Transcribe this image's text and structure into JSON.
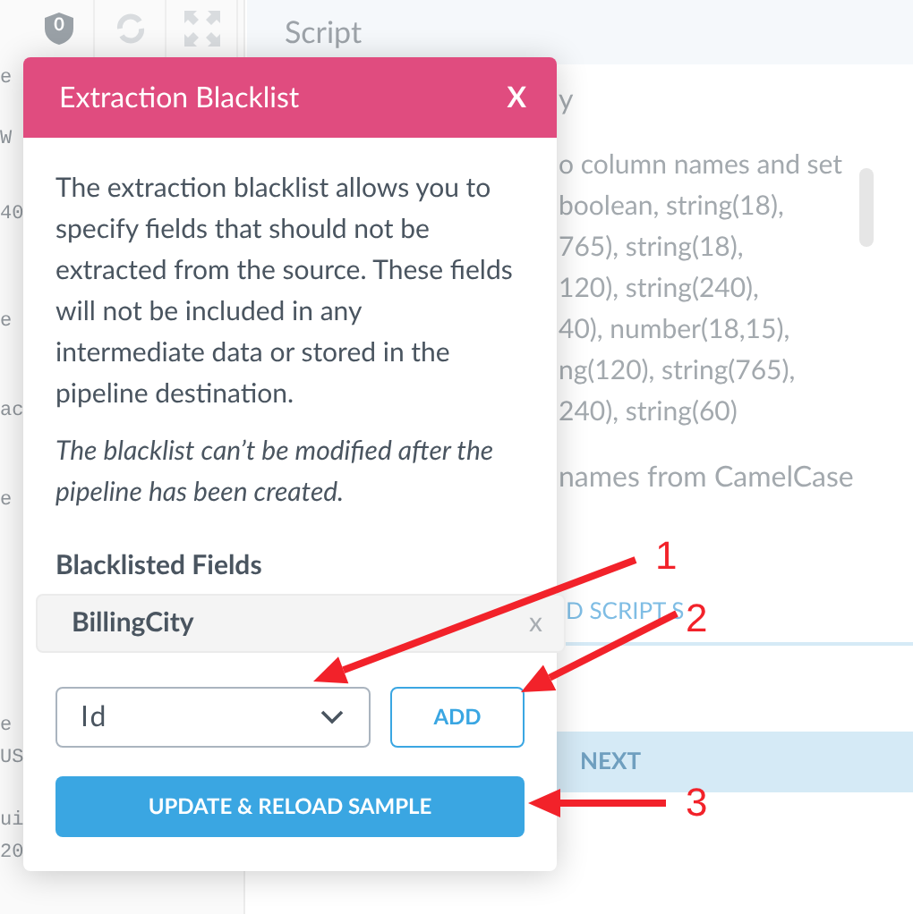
{
  "sidebar": {
    "toolbar": [
      {
        "kind": "shield",
        "badge": "0"
      },
      {
        "kind": "refresh"
      },
      {
        "kind": "expand"
      }
    ],
    "fragments": [
      "e",
      "W",
      "40",
      "e",
      "ac",
      "e",
      "e",
      "US",
      "ui",
      "20"
    ]
  },
  "main": {
    "header": "Script",
    "heading_fragment": "y",
    "lines": [
      "o column names and set",
      "boolean, string(18),",
      "765), string(18),",
      "120), string(240),",
      "40), number(18,15),",
      "ng(120), string(765),",
      "240), string(60)"
    ],
    "option_fragment": "names from CamelCase",
    "link": "D SCRIPT S",
    "next_button": "NEXT"
  },
  "dialog": {
    "title": "Extraction Blacklist",
    "close": "X",
    "description": "The extraction blacklist allows you to specify fields that should not be extracted from the source. These fields will not be included in any intermediate data or stored in the pipeline destination.",
    "note": "The blacklist can’t be modified after the pipeline has been created.",
    "fields_label": "Blacklisted Fields",
    "fields": [
      {
        "name": "BillingCity",
        "remove": "x"
      }
    ],
    "select": {
      "value": "Id"
    },
    "add_button": "ADD",
    "update_button": "UPDATE & RELOAD SAMPLE"
  },
  "annotations": [
    {
      "label": "1"
    },
    {
      "label": "2"
    },
    {
      "label": "3"
    }
  ]
}
